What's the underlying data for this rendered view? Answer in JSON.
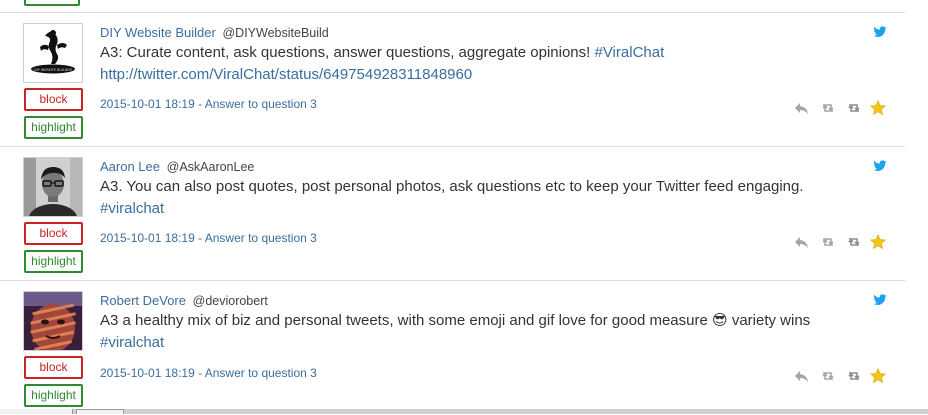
{
  "buttons": {
    "block_label": "block",
    "highlight_label": "highlight"
  },
  "colors": {
    "link": "#3b6e9e",
    "block": "#cc2222",
    "highlight": "#2e8b2e",
    "twitter": "#1da1f2",
    "star": "#f5c518"
  },
  "icons": [
    "twitter-bird-icon",
    "reply-icon",
    "retweet-icon",
    "retweet-icon",
    "favorite-star-icon"
  ],
  "tweets": [
    {
      "author_name": "DIY Website Builder",
      "author_handle": "@DIYWebsiteBuild",
      "text_main": "A3: Curate content, ask questions, answer questions, aggregate opinions!",
      "hashtag": "#ViralChat",
      "link": "http://twitter.com/ViralChat/status/649754928311848960",
      "meta": "2015-10-01 18:19 - Answer to question 3"
    },
    {
      "author_name": "Aaron Lee",
      "author_handle": "@AskAaronLee",
      "text_main": "A3. You can also post quotes, post personal photos, ask questions etc to keep your Twitter feed engaging.",
      "hashtag": "#viralchat",
      "meta": "2015-10-01 18:19 - Answer to question 3"
    },
    {
      "author_name": "Robert DeVore",
      "author_handle": "@deviorobert",
      "text_main": "A3 a healthy mix of biz and personal tweets, with some emoji and gif love for good measure",
      "emoji": "😎",
      "text_after": "variety wins",
      "hashtag": "#viralchat",
      "meta": "2015-10-01 18:19 - Answer to question 3"
    }
  ]
}
